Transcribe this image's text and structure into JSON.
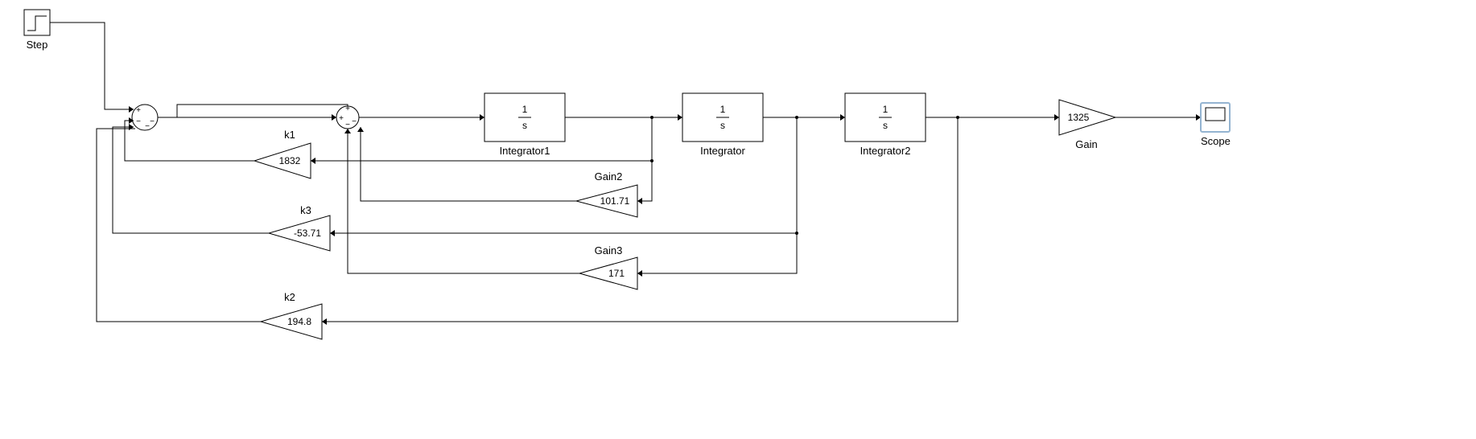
{
  "blocks": {
    "step": {
      "label": "Step"
    },
    "sum1": {
      "signs": [
        "+",
        "-",
        "-",
        "-"
      ]
    },
    "sum2": {
      "signs": [
        "+",
        "+",
        "-",
        "-"
      ]
    },
    "integrator1": {
      "label": "Integrator1",
      "text_top": "1",
      "text_bot": "s"
    },
    "integrator": {
      "label": "Integrator",
      "text_top": "1",
      "text_bot": "s"
    },
    "integrator2": {
      "label": "Integrator2",
      "text_top": "1",
      "text_bot": "s"
    },
    "gain": {
      "label": "Gain",
      "value": "1325"
    },
    "gain2": {
      "label": "Gain2",
      "value": "101.71"
    },
    "gain3": {
      "label": "Gain3",
      "value": "171"
    },
    "k1": {
      "label": "k1",
      "value": "1832"
    },
    "k2": {
      "label": "k2",
      "value": "194.8"
    },
    "k3": {
      "label": "k3",
      "value": "-53.71"
    },
    "scope": {
      "label": "Scope"
    }
  }
}
